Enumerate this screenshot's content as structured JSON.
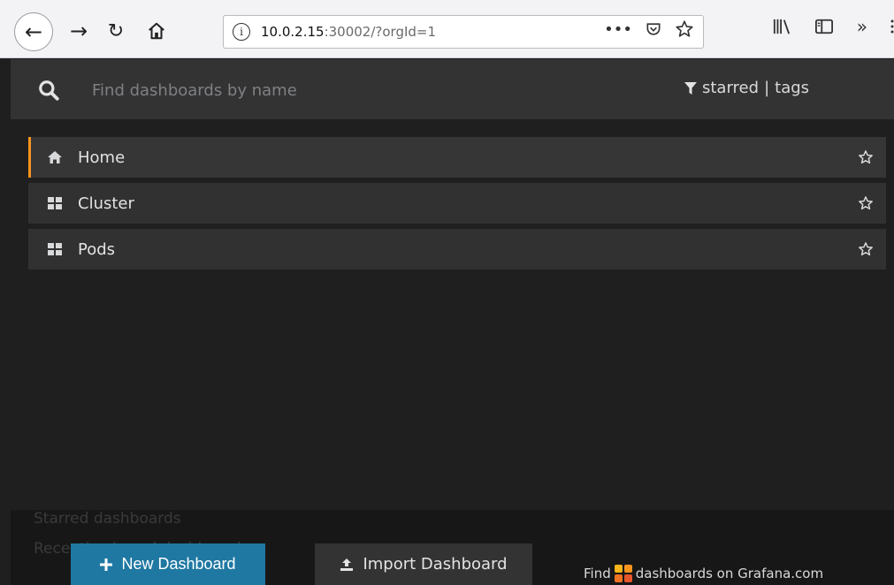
{
  "browser": {
    "url_host": "10.0.2.15",
    "url_rest": ":30002/?orgId=1",
    "url_menu": "•••"
  },
  "search": {
    "placeholder": "Find dashboards by name",
    "filter_starred": "starred",
    "filter_separator": "|",
    "filter_tags": "tags"
  },
  "results": [
    {
      "label": "Home",
      "icon": "home-icon",
      "selected": true
    },
    {
      "label": "Cluster",
      "icon": "dashboard-grid-icon",
      "selected": false
    },
    {
      "label": "Pods",
      "icon": "dashboard-grid-icon",
      "selected": false
    }
  ],
  "background_panels": {
    "starred": "Starred dashboards",
    "recent": "Recently viewed dashboards"
  },
  "actions": {
    "new_dashboard": "New Dashboard",
    "import_dashboard": "Import Dashboard",
    "find_prefix": "Find",
    "find_suffix": "dashboards on Grafana.com"
  },
  "colors": {
    "accent": "#f7941d",
    "primary_button": "#1f78a2",
    "grafana_logo": [
      "#f9b51a",
      "#f7941d",
      "#ee7221",
      "#e8562a"
    ]
  }
}
